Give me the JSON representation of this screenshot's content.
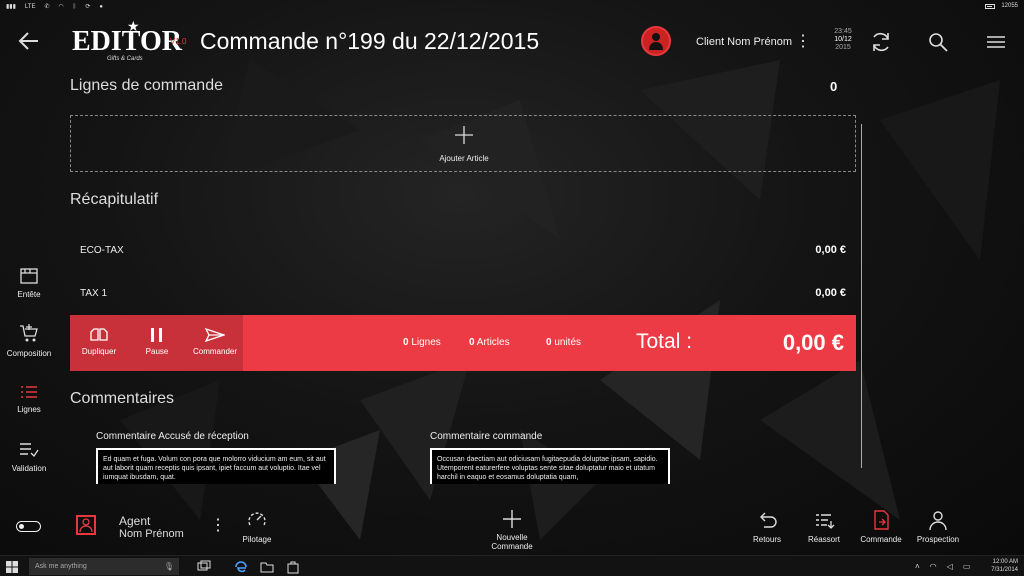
{
  "statusbar": {
    "carrier": "LTE",
    "battery": "12055"
  },
  "header": {
    "logo": "EDITOR",
    "logo_sub": "Gifts & Cards",
    "version": "V1.0",
    "title": "Commande n°199 du 22/12/2015",
    "client": "Client Nom Prénom",
    "time": "23:45",
    "date": "10/12",
    "year": "2015"
  },
  "nav": [
    {
      "label": "Entête",
      "icon": "header-icon"
    },
    {
      "label": "Composition",
      "icon": "cart-icon"
    },
    {
      "label": "Lignes",
      "icon": "list-icon",
      "active": true
    },
    {
      "label": "Validation",
      "icon": "checklist-icon"
    }
  ],
  "lines": {
    "title": "Lignes de commande",
    "count": "0",
    "add_label": "Ajouter Article"
  },
  "summary": {
    "title": "Récapitulatif",
    "rows": [
      {
        "label": "ECO-TAX",
        "value": "0,00 €"
      },
      {
        "label": "TAX 1",
        "value": "0,00 €"
      }
    ]
  },
  "totalbar": {
    "actions": [
      "Dupliquer",
      "Pause",
      "Commander"
    ],
    "lines_count": "0",
    "lines_label": " Lignes",
    "articles_count": "0",
    "articles_label": " Articles",
    "units_count": "0",
    "units_label": " unités",
    "total_label": "Total :",
    "total_value": "0,00 €",
    "color": "#ec3b44"
  },
  "comments": {
    "title": "Commentaires",
    "reception_label": "Commentaire Accusé de réception",
    "reception_text": "Ed quam et fuga. Volum con pora que molorro viducium am eum, sit aut aut laborit quam receptis quis ipsant, ipiet faccum aut voluptio. Itae vel iumquat ibusdam, quat.",
    "order_label": "Commentaire commande",
    "order_text": "Occusan daectiam aut odiciusam fugitaepudia doluptae ipsam, sapidio. Utemporent eaturerfere voluptas sente sitae doluptatur maio et utatum harchil in eaquo et eosamus doluptatia quam,"
  },
  "appbar": {
    "agent_label": "Agent",
    "agent_name": "Nom Prénom",
    "pilotage": "Pilotage",
    "new_order": "Nouvelle Commande",
    "retours": "Retours",
    "reassort": "Réassort",
    "commande": "Commande",
    "prospection": "Prospection"
  },
  "taskbar": {
    "search_placeholder": "Ask me anything",
    "clock_time": "12:00 AM",
    "clock_date": "7/31/2014"
  }
}
